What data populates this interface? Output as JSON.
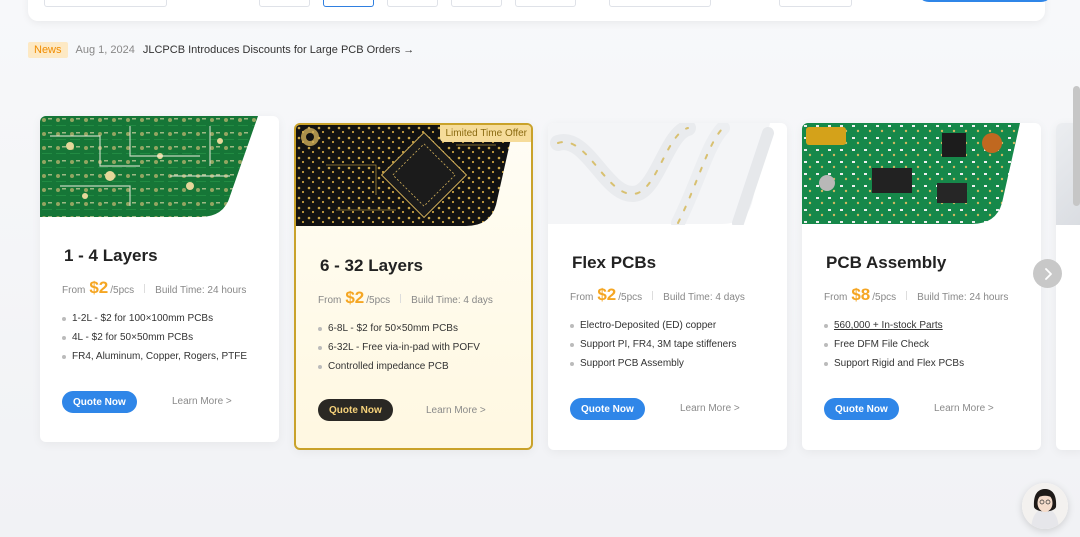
{
  "news": {
    "badge": "News",
    "date": "Aug 1, 2024",
    "title": "JLCPCB Introduces Discounts for Large PCB Orders →"
  },
  "cards": [
    {
      "title": "1 - 4 Layers",
      "price_prefix": "From",
      "price": "$2",
      "price_unit": "/5pcs",
      "build_time": "Build Time: 24 hours",
      "features": [
        "1-2L - $2 for 100×100mm PCBs",
        "4L - $2 for 50×50mm PCBs",
        "FR4, Aluminum, Copper, Rogers, PTFE"
      ],
      "quote_label": "Quote Now",
      "learn_label": "Learn More >"
    },
    {
      "title": "6 - 32 Layers",
      "badge": "Limited Time Offer",
      "price_prefix": "From",
      "price": "$2",
      "price_unit": "/5pcs",
      "build_time": "Build Time: 4 days",
      "features": [
        "6-8L - $2 for 50×50mm PCBs",
        "6-32L - Free via-in-pad with POFV",
        "Controlled impedance PCB"
      ],
      "quote_label": "Quote Now",
      "learn_label": "Learn More >"
    },
    {
      "title": "Flex PCBs",
      "price_prefix": "From",
      "price": "$2",
      "price_unit": "/5pcs",
      "build_time": "Build Time: 4 days",
      "features": [
        "Electro-Deposited (ED) copper",
        "Support PI, FR4, 3M tape stiffeners",
        "Support PCB Assembly"
      ],
      "quote_label": "Quote Now",
      "learn_label": "Learn More >"
    },
    {
      "title": "PCB Assembly",
      "price_prefix": "From",
      "price": "$8",
      "price_unit": "/5pcs",
      "build_time": "Build Time: 24 hours",
      "features": [
        "560,000 + In-stock Parts",
        "Free DFM File Check",
        "Support Rigid and Flex PCBs"
      ],
      "quote_label": "Quote Now",
      "learn_label": "Learn More >"
    }
  ],
  "colors": {
    "accent": "#2f86e8",
    "price": "#f5a623",
    "highlight_border": "#c9a22a",
    "news_badge_bg": "#fde9c4"
  }
}
